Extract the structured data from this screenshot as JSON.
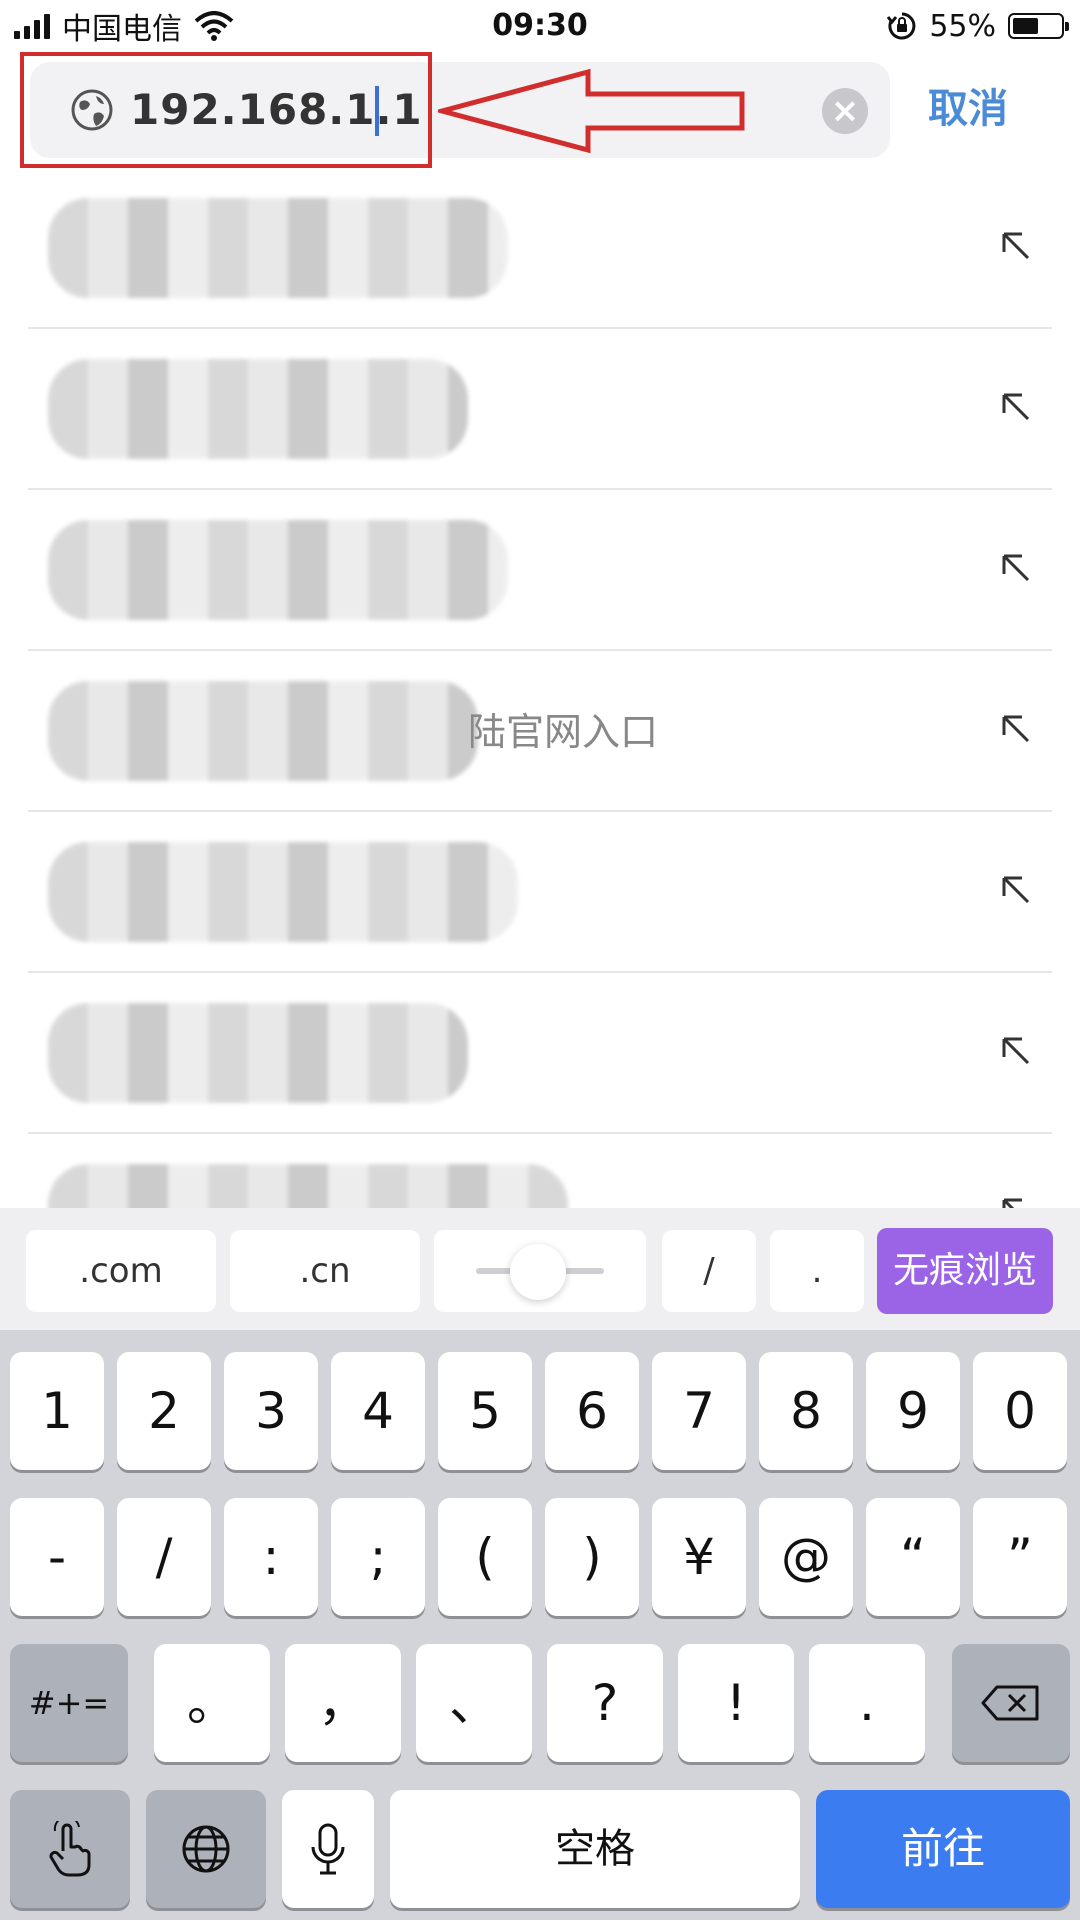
{
  "status_bar": {
    "carrier": "中国电信",
    "time": "09:30",
    "battery_percent_text": "55%",
    "battery_level": 0.55,
    "signal_icon": "signal-bars-icon",
    "wifi_icon": "wifi-icon",
    "rotation_lock_icon": "rotation-lock-icon"
  },
  "address_bar": {
    "value": "192.168.1.1",
    "globe_icon": "globe-icon",
    "clear_icon": "clear-icon",
    "clear_glyph": "×",
    "cancel_label": "取消"
  },
  "annotation": {
    "color": "#d22d2d"
  },
  "suggestions": [
    {
      "text": ""
    },
    {
      "text": ""
    },
    {
      "text": ""
    },
    {
      "text": "陆官网入口"
    },
    {
      "text": ""
    },
    {
      "text": ""
    },
    {
      "text": ""
    }
  ],
  "keyboard_toolbar": {
    "keys": [
      ".com",
      ".cn",
      "/",
      "."
    ],
    "incognito_label": "无痕浏览",
    "incognito_color": "#9b64e6"
  },
  "keyboard": {
    "row1": [
      "1",
      "2",
      "3",
      "4",
      "5",
      "6",
      "7",
      "8",
      "9",
      "0"
    ],
    "row2": [
      "-",
      "/",
      ":",
      ";",
      "(",
      ")",
      "¥",
      "@",
      "“",
      "”"
    ],
    "row3": [
      "。",
      "，",
      "、",
      "?",
      "!",
      "."
    ],
    "symbols_label": "#+=",
    "space_label": "空格",
    "go_label": "前往",
    "backspace_icon": "backspace-icon",
    "globe_icon": "keyboard-globe-icon",
    "mic_icon": "microphone-icon",
    "gesture_icon": "hand-pointer-icon",
    "go_color": "#3b7df0"
  }
}
